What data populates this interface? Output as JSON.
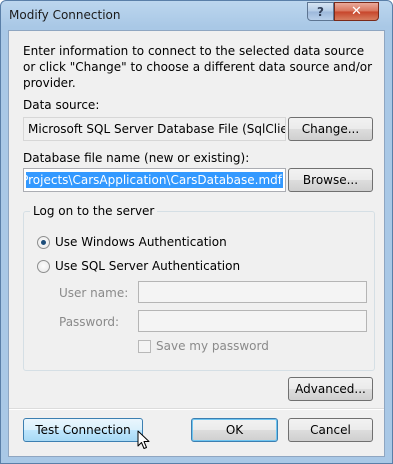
{
  "window": {
    "title": "Modify Connection",
    "help_label": "?",
    "close_label": "✕"
  },
  "intro_text": "Enter information to connect to the selected data source or click \"Change\" to choose a different data source and/or provider.",
  "data_source": {
    "label": "Data source:",
    "value": "Microsoft SQL Server Database File (SqlClient)",
    "change_button": "Change..."
  },
  "database_file": {
    "label": "Database file name (new or existing):",
    "value": "ary Projects\\CarsApplication\\CarsDatabase.mdf",
    "browse_button": "Browse..."
  },
  "logon": {
    "group_title": "Log on to the server",
    "windows_auth_label": "Use Windows Authentication",
    "windows_auth_selected": true,
    "sql_auth_label": "Use SQL Server Authentication",
    "sql_auth_selected": false,
    "user_name_label": "User name:",
    "user_name_value": "",
    "password_label": "Password:",
    "password_value": "",
    "save_password_label": "Save my password",
    "save_password_checked": false
  },
  "buttons": {
    "advanced": "Advanced...",
    "test_connection": "Test Connection",
    "ok": "OK",
    "cancel": "Cancel"
  },
  "colors": {
    "title_bar": "#a9c8e6",
    "close_button": "#c7442a",
    "selection": "#3399ff",
    "default_button_border": "#3c7fb1"
  }
}
